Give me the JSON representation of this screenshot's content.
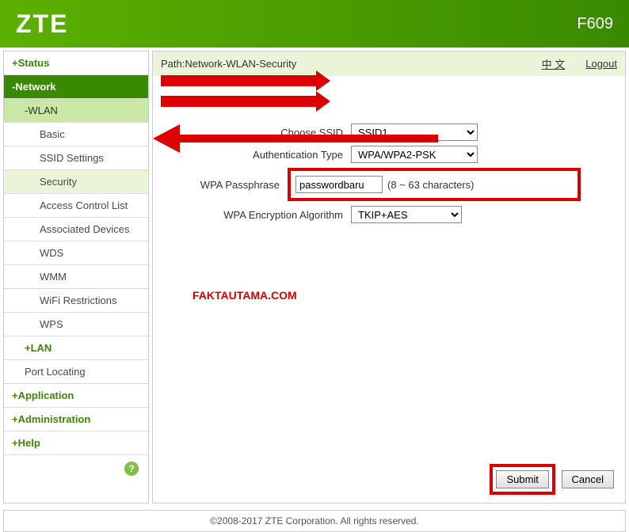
{
  "header": {
    "brand": "ZTE",
    "model": "F609"
  },
  "sidebar": {
    "status": "+Status",
    "network": "-Network",
    "wlan": "-WLAN",
    "basic": "Basic",
    "ssid_settings": "SSID Settings",
    "security": "Security",
    "acl": "Access Control List",
    "assoc": "Associated Devices",
    "wds": "WDS",
    "wmm": "WMM",
    "wifi_restrictions": "WiFi Restrictions",
    "wps": "WPS",
    "lan": "+LAN",
    "port_locating": "Port Locating",
    "application": "+Application",
    "administration": "+Administration",
    "help": "+Help"
  },
  "pathbar": {
    "path": "Path:Network-WLAN-Security",
    "lang": "中 文",
    "logout": "Logout"
  },
  "form": {
    "choose_ssid_label": "Choose SSID",
    "choose_ssid_value": "SSID1",
    "auth_type_label": "Authentication Type",
    "auth_type_value": "WPA/WPA2-PSK",
    "passphrase_label": "WPA Passphrase",
    "passphrase_value": "passwordbaru",
    "passphrase_hint": "(8 ~ 63 characters)",
    "enc_algo_label": "WPA Encryption Algorithm",
    "enc_algo_value": "TKIP+AES"
  },
  "watermark": "FAKTAUTAMA.COM",
  "buttons": {
    "submit": "Submit",
    "cancel": "Cancel"
  },
  "footer": "©2008-2017 ZTE Corporation. All rights reserved.",
  "help_icon": "?"
}
